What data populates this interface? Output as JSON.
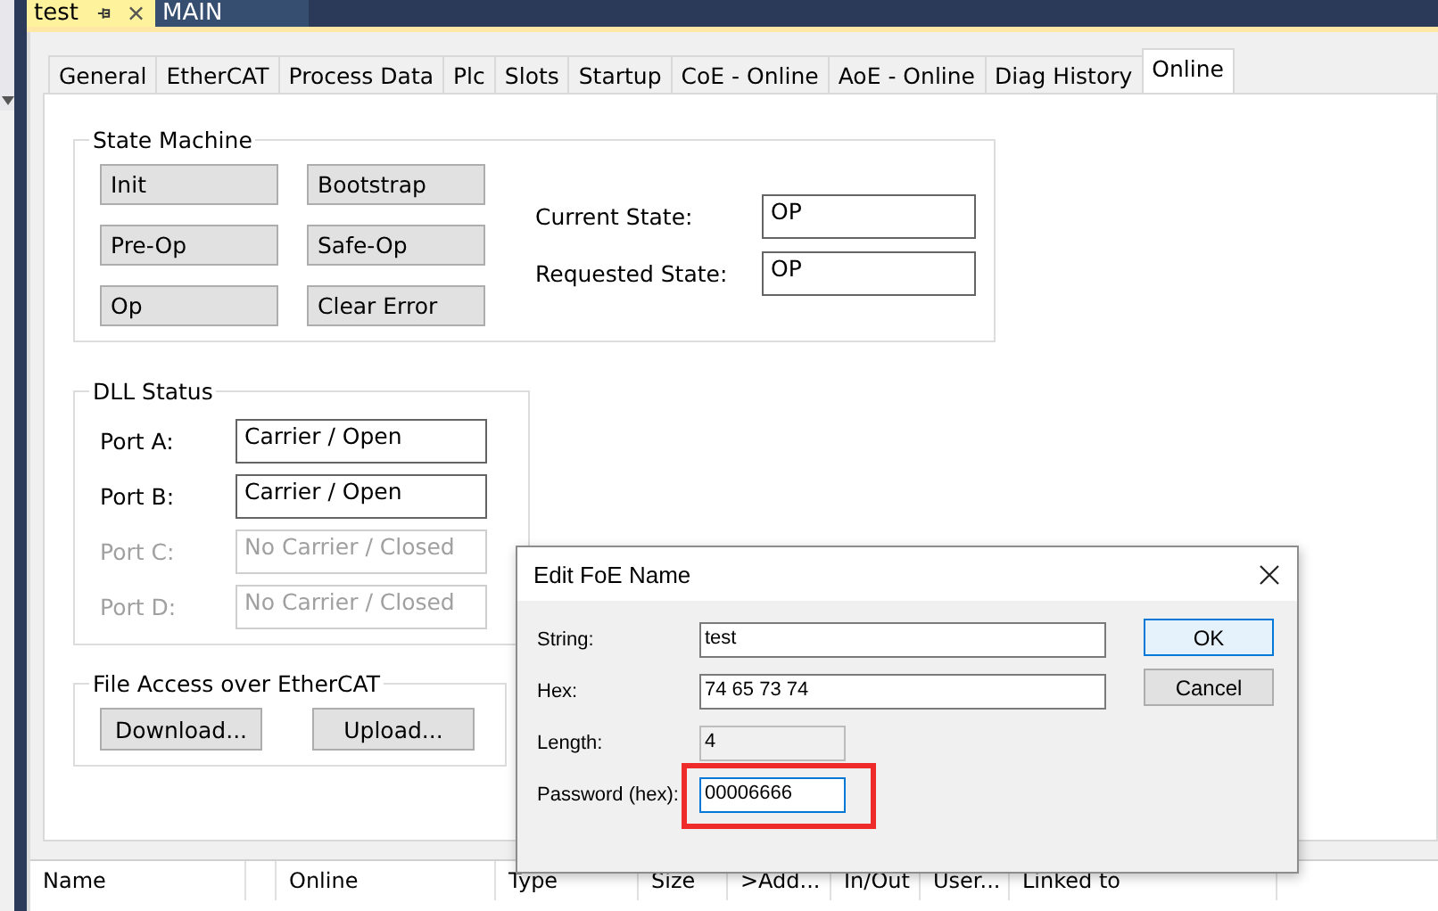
{
  "document_tabs": [
    {
      "label": "test",
      "selected": true
    },
    {
      "label": "MAIN",
      "selected": false
    }
  ],
  "property_tabs": [
    {
      "label": "General",
      "selected": false
    },
    {
      "label": "EtherCAT",
      "selected": false
    },
    {
      "label": "Process Data",
      "selected": false
    },
    {
      "label": "Plc",
      "selected": false
    },
    {
      "label": "Slots",
      "selected": false
    },
    {
      "label": "Startup",
      "selected": false
    },
    {
      "label": "CoE - Online",
      "selected": false
    },
    {
      "label": "AoE - Online",
      "selected": false
    },
    {
      "label": "Diag History",
      "selected": false
    },
    {
      "label": "Online",
      "selected": true
    }
  ],
  "state_machine": {
    "title": "State Machine",
    "buttons": [
      "Init",
      "Bootstrap",
      "Pre-Op",
      "Safe-Op",
      "Op",
      "Clear Error"
    ],
    "fields": [
      {
        "label": "Current State:",
        "value": "OP"
      },
      {
        "label": "Requested State:",
        "value": "OP"
      }
    ]
  },
  "dll_status": {
    "title": "DLL Status",
    "ports": [
      {
        "label": "Port A:",
        "value": "Carrier / Open",
        "disabled": false
      },
      {
        "label": "Port B:",
        "value": "Carrier / Open",
        "disabled": false
      },
      {
        "label": "Port C:",
        "value": "No Carrier / Closed",
        "disabled": true
      },
      {
        "label": "Port D:",
        "value": "No Carrier / Closed",
        "disabled": true
      }
    ]
  },
  "file_access": {
    "title": "File Access over EtherCAT",
    "buttons": [
      "Download...",
      "Upload..."
    ]
  },
  "variables_table": {
    "columns": [
      "Name",
      "Online",
      "Type",
      "Size",
      ">Add...",
      "In/Out",
      "User...",
      "Linked to"
    ]
  },
  "dialog": {
    "title": "Edit FoE Name",
    "fields": [
      {
        "label": "String:",
        "value": "test",
        "disabled": false,
        "focused": false,
        "highlighted": false
      },
      {
        "label": "Hex:",
        "value": "74 65 73 74",
        "disabled": false,
        "focused": false,
        "highlighted": false
      },
      {
        "label": "Length:",
        "value": "4",
        "disabled": true,
        "focused": false,
        "highlighted": false
      },
      {
        "label": "Password (hex):",
        "value": "00006666",
        "disabled": false,
        "focused": true,
        "highlighted": true
      }
    ],
    "buttons": [
      {
        "label": "OK",
        "default": true
      },
      {
        "label": "Cancel",
        "default": false
      }
    ]
  }
}
